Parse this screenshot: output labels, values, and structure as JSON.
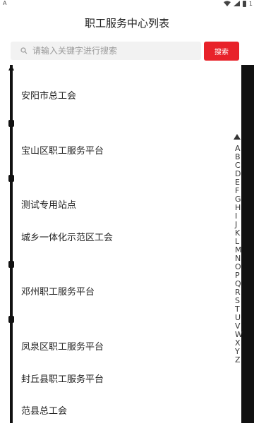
{
  "status": {
    "left_glyph": "A",
    "right_text": "1"
  },
  "header": {
    "title": "职工服务中心列表"
  },
  "search": {
    "placeholder": "请输入关键字进行搜索",
    "button_label": "搜索"
  },
  "list": {
    "items": [
      "安阳市总工会",
      "宝山区职工服务平台",
      "测试专用站点",
      "城乡一体化示范区工会",
      "邓州职工服务平台",
      "凤泉区职工服务平台",
      "封丘县职工服务平台",
      "范县总工会"
    ]
  },
  "index": {
    "letters": [
      "A",
      "B",
      "C",
      "D",
      "E",
      "F",
      "G",
      "H",
      "I",
      "J",
      "K",
      "L",
      "M",
      "N",
      "O",
      "P",
      "Q",
      "R",
      "S",
      "T",
      "U",
      "V",
      "W",
      "X",
      "Y",
      "Z"
    ]
  },
  "colors": {
    "accent": "#e8222a",
    "search_bg": "#f2f2f2"
  },
  "icons": {
    "search": "search-icon",
    "wifi": "wifi-icon",
    "signal": "signal-icon",
    "battery": "battery-icon",
    "scroll_up": "triangle-up-icon"
  }
}
